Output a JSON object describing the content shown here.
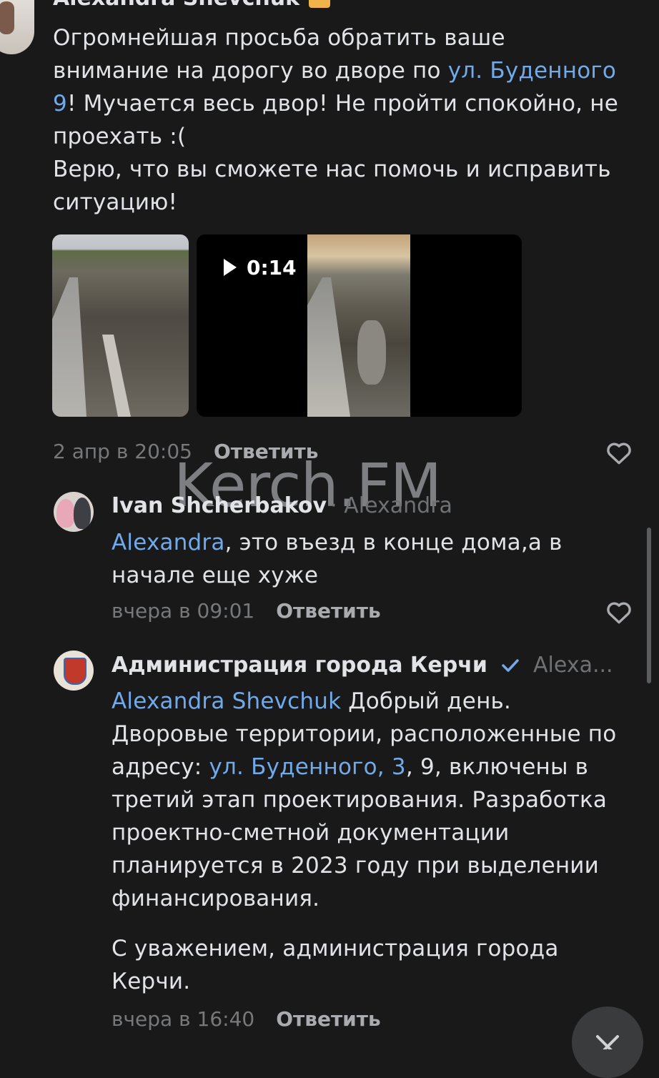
{
  "post": {
    "author": "Alexandra Shevchuk",
    "author_badge_icon": "gift-icon",
    "text_1": "Огромнейшая просьба обратить ваше внимание на дорогу во дворе по ",
    "text_link": "ул. Буденного 9",
    "text_2": "! Мучается весь двор! Не пройти спокойно, не проехать :(",
    "text_3": "Верю, что вы сможете нас помочь и исправить ситуацию!",
    "video_duration": "0:14",
    "timestamp": "2 апр в 20:05",
    "reply_label": "Ответить"
  },
  "watermark": "Kerch.FM",
  "comments": [
    {
      "author": "Ivan Shcherbakov",
      "reply_to": "Alexandra",
      "mention": "Alexandra",
      "text": ", это въезд в конце дома,а в начале еще хуже",
      "timestamp": "вчера в 09:01",
      "reply_label": "Ответить"
    },
    {
      "author": "Администрация города Керчи",
      "verified_icon": "verified-check-icon",
      "reply_to": "Alexa...",
      "mention": "Alexandra Shevchuk",
      "text_1": " Добрый день. Дворовые территории, расположенные по адресу: ",
      "link": "ул. Буденного, 3",
      "text_2": ", 9, включены в третий этап проектирования. Разработка проектно-сметной документации планируется в 2023 году при выделении финансирования.",
      "text_3": "С уважением, администрация города Керчи.",
      "timestamp": "вчера в 16:40",
      "reply_label": "Ответить"
    }
  ],
  "colors": {
    "background": "#19191a",
    "link": "#71aaeb",
    "text": "#e1e3e6",
    "muted": "#76787a"
  }
}
